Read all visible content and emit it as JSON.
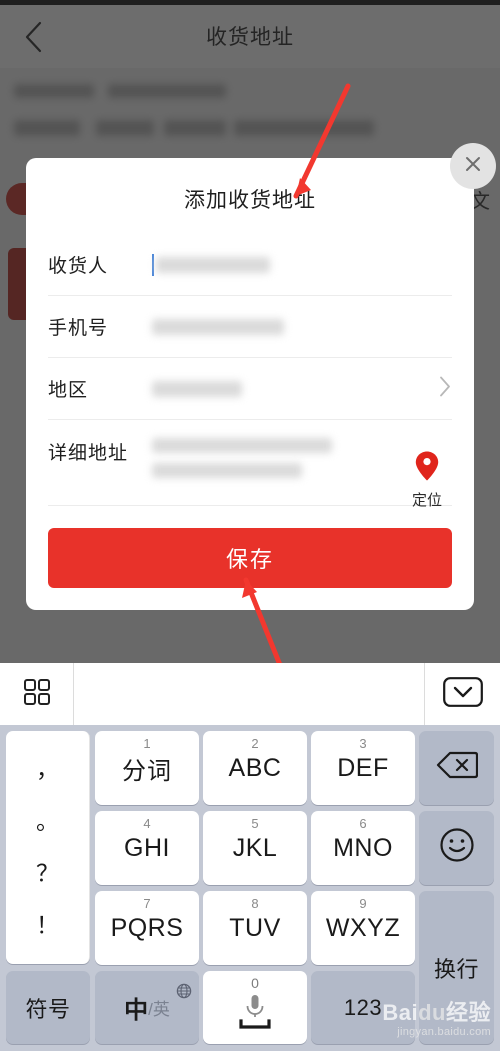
{
  "background_page": {
    "header_title": "收货地址",
    "back_icon": "chevron-left-icon",
    "redacted_address_card": "••••••  ••••••••••••",
    "side_text": "文"
  },
  "modal": {
    "title": "添加收货地址",
    "close_icon": "close-icon",
    "fields": [
      {
        "label": "收货人",
        "value": "",
        "placeholder": "",
        "redacted": true,
        "has_caret": true,
        "has_chevron": false
      },
      {
        "label": "手机号",
        "value": "",
        "placeholder": "",
        "redacted": true,
        "has_caret": false,
        "has_chevron": false
      },
      {
        "label": "地区",
        "value": "",
        "placeholder": "",
        "redacted": true,
        "has_caret": false,
        "has_chevron": true
      },
      {
        "label": "详细地址",
        "value": "",
        "placeholder": "",
        "redacted": true,
        "has_caret": false,
        "has_chevron": false
      }
    ],
    "locate": {
      "label": "定位",
      "icon": "location-pin-icon",
      "color": "#e0251c"
    },
    "save_label": "保存",
    "save_color": "#e8322a"
  },
  "keyboard": {
    "toolbar": {
      "grid_icon": "grid-apps-icon",
      "hide_icon": "chevron-down-icon"
    },
    "punctuation_key": {
      "name": "punctuation-key",
      "glyphs": [
        "，",
        "。",
        "？",
        "！"
      ]
    },
    "keys": [
      {
        "num": "1",
        "main": "分词",
        "cjk": true
      },
      {
        "num": "2",
        "main": "ABC",
        "cjk": false
      },
      {
        "num": "3",
        "main": "DEF",
        "cjk": false
      },
      {
        "num": "4",
        "main": "GHI",
        "cjk": false
      },
      {
        "num": "5",
        "main": "JKL",
        "cjk": false
      },
      {
        "num": "6",
        "main": "MNO",
        "cjk": false
      },
      {
        "num": "7",
        "main": "PQRS",
        "cjk": false
      },
      {
        "num": "8",
        "main": "TUV",
        "cjk": false
      },
      {
        "num": "9",
        "main": "WXYZ",
        "cjk": false
      }
    ],
    "backspace": {
      "label": "",
      "icon": "backspace-icon"
    },
    "emoji": {
      "label": "",
      "icon": "emoji-smiley-icon"
    },
    "enter": {
      "label": "换行"
    },
    "symbols": {
      "label": "符号"
    },
    "language": {
      "main": "中",
      "sub": "/英",
      "icon": "globe-icon"
    },
    "space": {
      "num": "0",
      "icon": "microphone-icon"
    },
    "numeric": {
      "label": "123"
    }
  },
  "watermark": {
    "brand_a": "Bai",
    "brand_b": "du",
    "brand_c": "经验",
    "url": "jingyan.baidu.com"
  }
}
